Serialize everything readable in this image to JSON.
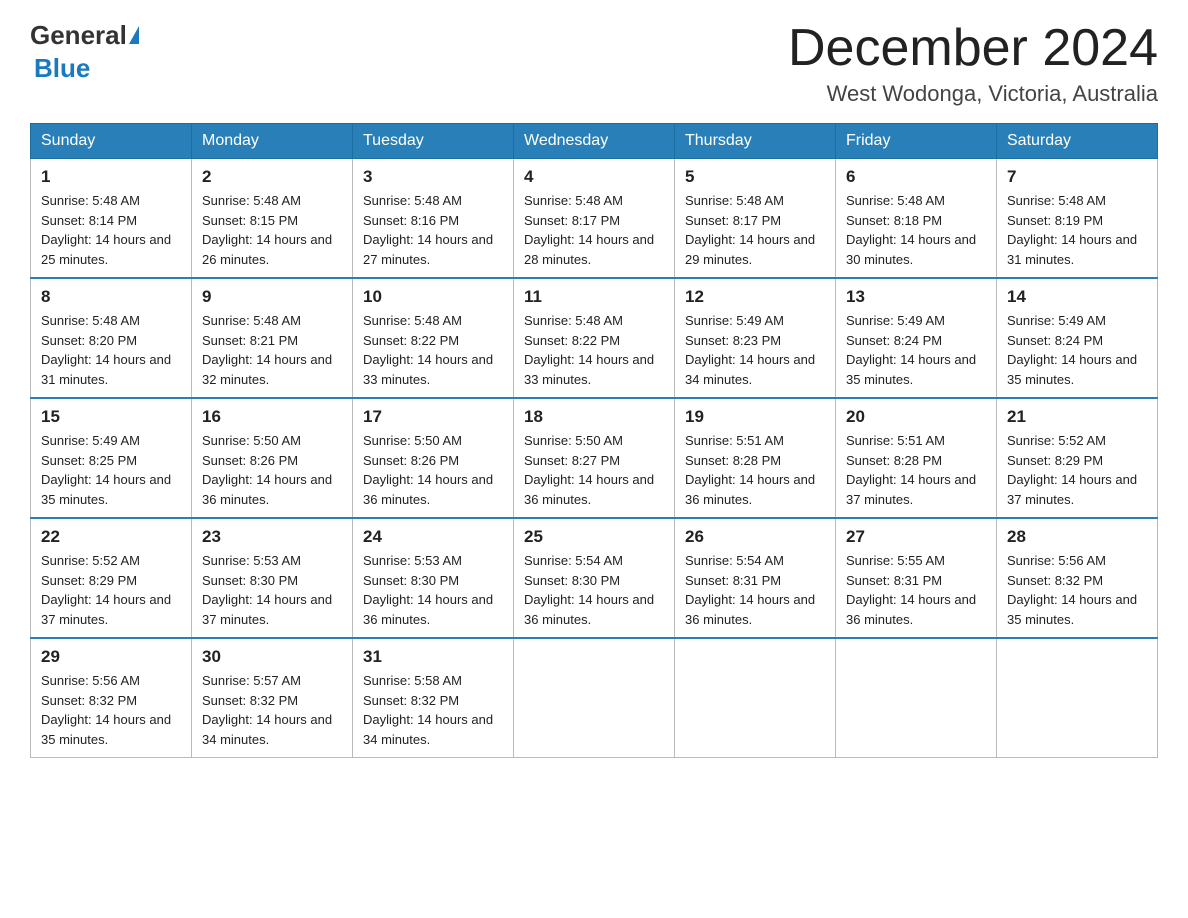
{
  "logo": {
    "general": "General",
    "blue": "Blue",
    "triangle_color": "#1a7abf"
  },
  "title": {
    "month_year": "December 2024",
    "location": "West Wodonga, Victoria, Australia"
  },
  "header_days": [
    "Sunday",
    "Monday",
    "Tuesday",
    "Wednesday",
    "Thursday",
    "Friday",
    "Saturday"
  ],
  "weeks": [
    [
      {
        "day": "1",
        "sunrise": "Sunrise: 5:48 AM",
        "sunset": "Sunset: 8:14 PM",
        "daylight": "Daylight: 14 hours and 25 minutes."
      },
      {
        "day": "2",
        "sunrise": "Sunrise: 5:48 AM",
        "sunset": "Sunset: 8:15 PM",
        "daylight": "Daylight: 14 hours and 26 minutes."
      },
      {
        "day": "3",
        "sunrise": "Sunrise: 5:48 AM",
        "sunset": "Sunset: 8:16 PM",
        "daylight": "Daylight: 14 hours and 27 minutes."
      },
      {
        "day": "4",
        "sunrise": "Sunrise: 5:48 AM",
        "sunset": "Sunset: 8:17 PM",
        "daylight": "Daylight: 14 hours and 28 minutes."
      },
      {
        "day": "5",
        "sunrise": "Sunrise: 5:48 AM",
        "sunset": "Sunset: 8:17 PM",
        "daylight": "Daylight: 14 hours and 29 minutes."
      },
      {
        "day": "6",
        "sunrise": "Sunrise: 5:48 AM",
        "sunset": "Sunset: 8:18 PM",
        "daylight": "Daylight: 14 hours and 30 minutes."
      },
      {
        "day": "7",
        "sunrise": "Sunrise: 5:48 AM",
        "sunset": "Sunset: 8:19 PM",
        "daylight": "Daylight: 14 hours and 31 minutes."
      }
    ],
    [
      {
        "day": "8",
        "sunrise": "Sunrise: 5:48 AM",
        "sunset": "Sunset: 8:20 PM",
        "daylight": "Daylight: 14 hours and 31 minutes."
      },
      {
        "day": "9",
        "sunrise": "Sunrise: 5:48 AM",
        "sunset": "Sunset: 8:21 PM",
        "daylight": "Daylight: 14 hours and 32 minutes."
      },
      {
        "day": "10",
        "sunrise": "Sunrise: 5:48 AM",
        "sunset": "Sunset: 8:22 PM",
        "daylight": "Daylight: 14 hours and 33 minutes."
      },
      {
        "day": "11",
        "sunrise": "Sunrise: 5:48 AM",
        "sunset": "Sunset: 8:22 PM",
        "daylight": "Daylight: 14 hours and 33 minutes."
      },
      {
        "day": "12",
        "sunrise": "Sunrise: 5:49 AM",
        "sunset": "Sunset: 8:23 PM",
        "daylight": "Daylight: 14 hours and 34 minutes."
      },
      {
        "day": "13",
        "sunrise": "Sunrise: 5:49 AM",
        "sunset": "Sunset: 8:24 PM",
        "daylight": "Daylight: 14 hours and 35 minutes."
      },
      {
        "day": "14",
        "sunrise": "Sunrise: 5:49 AM",
        "sunset": "Sunset: 8:24 PM",
        "daylight": "Daylight: 14 hours and 35 minutes."
      }
    ],
    [
      {
        "day": "15",
        "sunrise": "Sunrise: 5:49 AM",
        "sunset": "Sunset: 8:25 PM",
        "daylight": "Daylight: 14 hours and 35 minutes."
      },
      {
        "day": "16",
        "sunrise": "Sunrise: 5:50 AM",
        "sunset": "Sunset: 8:26 PM",
        "daylight": "Daylight: 14 hours and 36 minutes."
      },
      {
        "day": "17",
        "sunrise": "Sunrise: 5:50 AM",
        "sunset": "Sunset: 8:26 PM",
        "daylight": "Daylight: 14 hours and 36 minutes."
      },
      {
        "day": "18",
        "sunrise": "Sunrise: 5:50 AM",
        "sunset": "Sunset: 8:27 PM",
        "daylight": "Daylight: 14 hours and 36 minutes."
      },
      {
        "day": "19",
        "sunrise": "Sunrise: 5:51 AM",
        "sunset": "Sunset: 8:28 PM",
        "daylight": "Daylight: 14 hours and 36 minutes."
      },
      {
        "day": "20",
        "sunrise": "Sunrise: 5:51 AM",
        "sunset": "Sunset: 8:28 PM",
        "daylight": "Daylight: 14 hours and 37 minutes."
      },
      {
        "day": "21",
        "sunrise": "Sunrise: 5:52 AM",
        "sunset": "Sunset: 8:29 PM",
        "daylight": "Daylight: 14 hours and 37 minutes."
      }
    ],
    [
      {
        "day": "22",
        "sunrise": "Sunrise: 5:52 AM",
        "sunset": "Sunset: 8:29 PM",
        "daylight": "Daylight: 14 hours and 37 minutes."
      },
      {
        "day": "23",
        "sunrise": "Sunrise: 5:53 AM",
        "sunset": "Sunset: 8:30 PM",
        "daylight": "Daylight: 14 hours and 37 minutes."
      },
      {
        "day": "24",
        "sunrise": "Sunrise: 5:53 AM",
        "sunset": "Sunset: 8:30 PM",
        "daylight": "Daylight: 14 hours and 36 minutes."
      },
      {
        "day": "25",
        "sunrise": "Sunrise: 5:54 AM",
        "sunset": "Sunset: 8:30 PM",
        "daylight": "Daylight: 14 hours and 36 minutes."
      },
      {
        "day": "26",
        "sunrise": "Sunrise: 5:54 AM",
        "sunset": "Sunset: 8:31 PM",
        "daylight": "Daylight: 14 hours and 36 minutes."
      },
      {
        "day": "27",
        "sunrise": "Sunrise: 5:55 AM",
        "sunset": "Sunset: 8:31 PM",
        "daylight": "Daylight: 14 hours and 36 minutes."
      },
      {
        "day": "28",
        "sunrise": "Sunrise: 5:56 AM",
        "sunset": "Sunset: 8:32 PM",
        "daylight": "Daylight: 14 hours and 35 minutes."
      }
    ],
    [
      {
        "day": "29",
        "sunrise": "Sunrise: 5:56 AM",
        "sunset": "Sunset: 8:32 PM",
        "daylight": "Daylight: 14 hours and 35 minutes."
      },
      {
        "day": "30",
        "sunrise": "Sunrise: 5:57 AM",
        "sunset": "Sunset: 8:32 PM",
        "daylight": "Daylight: 14 hours and 34 minutes."
      },
      {
        "day": "31",
        "sunrise": "Sunrise: 5:58 AM",
        "sunset": "Sunset: 8:32 PM",
        "daylight": "Daylight: 14 hours and 34 minutes."
      },
      null,
      null,
      null,
      null
    ]
  ]
}
